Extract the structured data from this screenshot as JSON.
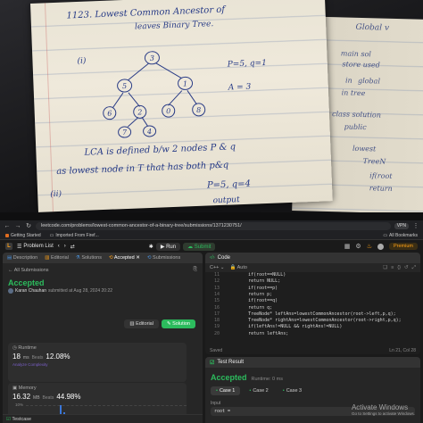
{
  "notebook": {
    "title_line1": "1123. Lowest Common Ancestor of",
    "title_line2": "leaves Binary Tree.",
    "example_label": "(i)",
    "tree_nodes": [
      "3",
      "5",
      "1",
      "6",
      "2",
      "0",
      "8",
      "7",
      "4"
    ],
    "given": "P=5, q=1",
    "answer": "A = 3",
    "lca_line1": "LCA is defined b/w 2 nodes P & q",
    "lca_line2": "as lowest node in T that has both p&q",
    "example2_label": "(ii)",
    "example2_given": "P=5, q=4",
    "example2_answer": "output",
    "right_page": [
      "Global v",
      "main sol",
      "store used",
      "in",
      "global",
      "in tree",
      "class solution",
      "public",
      "lowest",
      "TreeN",
      "if(root",
      "return"
    ]
  },
  "browser": {
    "url": "leetcode.com/problems/lowest-common-ancestor-of-a-binary-tree/submissions/1371230751/",
    "vpn": "VPN",
    "bookmarks": [
      "Getting Started",
      "Imported From Firef..."
    ],
    "all_bookmarks": "All Bookmarks"
  },
  "leetcode": {
    "logo": "L",
    "problem_list": "Problem List",
    "run": "Run",
    "submit": "Submit",
    "premium": "Premium",
    "tabs": [
      "Description",
      "Editorial",
      "Solutions",
      "Accepted",
      "Submissions"
    ],
    "all_submissions": "All Submissions",
    "status": "Accepted",
    "submitter_name": "Karan Chauhan",
    "submitted_at": "submitted at Aug 28, 2024 20:22",
    "editorial_btn": "Editorial",
    "solution_btn": "Solution",
    "runtime_title": "Runtime",
    "runtime_value": "18",
    "runtime_unit": "ms",
    "beats_label": "Beats",
    "runtime_beats": "12.08%",
    "analyze": "Analyze Complexity",
    "memory_title": "Memory",
    "memory_value": "16.32",
    "memory_unit": "MB",
    "memory_beats": "44.98%",
    "chart_ticks": [
      "10%",
      "5%"
    ],
    "chart_bars": [
      0.1,
      0.35,
      1.0,
      0.6,
      0.2
    ],
    "testcase": "Testcase",
    "code_title": "Code",
    "language": "C++",
    "auto": "Auto",
    "code_lines": [
      {
        "n": "11",
        "t": "        if(root==NULL)"
      },
      {
        "n": "12",
        "t": "        return NULL;"
      },
      {
        "n": "13",
        "t": "        if(root==p)"
      },
      {
        "n": "14",
        "t": "        return p;"
      },
      {
        "n": "15",
        "t": "        if(root==q)"
      },
      {
        "n": "16",
        "t": "        return q;"
      },
      {
        "n": "17",
        "t": "        TreeNode* leftAns=lowestCommonAncestor(root->left,p,q);"
      },
      {
        "n": "18",
        "t": "        TreeNode* rightAns=lowestCommonAncestor(root->right,p,q);"
      },
      {
        "n": "19",
        "t": "        if(leftAns!=NULL && rightAns!=NULL)"
      },
      {
        "n": "20",
        "t": "        return leftAns;"
      }
    ],
    "saved": "Saved",
    "cursor": "Ln 21, Col 28",
    "test_result": "Test Result",
    "result_status": "Accepted",
    "result_runtime": "Runtime: 0 ms",
    "cases": [
      "Case 1",
      "Case 2",
      "Case 3"
    ],
    "input_label": "Input",
    "input_value": "root ="
  },
  "windows": {
    "activate_title": "Activate Windows",
    "activate_sub": "Go to Settings to activate Windows."
  }
}
